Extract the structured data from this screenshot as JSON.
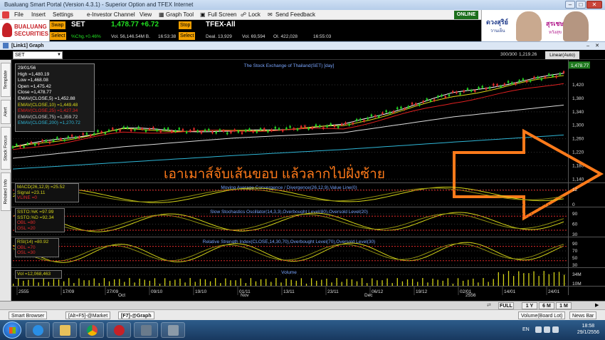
{
  "window": {
    "title": "Bualuang Smart Portal (Version 4.3.1) - Superior Option and TFEX Internet"
  },
  "menu": {
    "items": [
      "File",
      "Insert",
      "Settings",
      "e-Investor Channel",
      "View",
      "Graph Tool",
      "Full Screen",
      "Lock",
      "Send Feedback"
    ],
    "online": "ONLINE"
  },
  "brand": {
    "line1": "BUALUANG",
    "line2": "SECURITIES"
  },
  "ad": {
    "text1": "ดวงสุริย์",
    "sub1": "วานเย็น",
    "text2": "สุรเชษฐ์",
    "sub2": "หวังสุข"
  },
  "ticker": {
    "swap_label": "Swap",
    "select_label": "Select",
    "set": {
      "symbol": "SET",
      "price": "1,478.77 +6.72",
      "pct": "%Chg.+0.46%",
      "vol": "Vol. 56,146.54M B.",
      "time": "16:53:38"
    },
    "stop_label": "Stop",
    "tfex": {
      "symbol": "TFEX-All",
      "deal": "Deal. 13,929",
      "vol": "Vol. 69,594",
      "oi": "OI. 422,028",
      "time": "16:55:03"
    }
  },
  "chart_window": {
    "title": "[Link1] Graph",
    "symbol_select": "SET",
    "bar_count": "300/300",
    "price_readout": "1,219.26",
    "scale_mode": "Linear(Auto)"
  },
  "side_tabs": [
    "Template",
    "Alert",
    "Stock Focus",
    "Related Info"
  ],
  "info_box": {
    "date": "29/01/56",
    "high": "High  =1,480.19",
    "low": "Low  =1,468.08",
    "open": "Open  =1,475.42",
    "close": "Close  =1,478.77",
    "ema5": "EMAV(CLOSE,5)  =1,452.88",
    "ema10": "EMAV(CLOSE,10)  =1,449.48",
    "ema25": "EMAV(CLOSE,25)  =1,427.34",
    "ema75": "EMAV(CLOSE,75)  =1,359.72",
    "ema200": "EMAV(CLOSE,200)  =1,270.72"
  },
  "colors": {
    "ema5": "#ffffff",
    "ema10": "#d8d818",
    "ema25": "#e02020",
    "ema75": "#dcdcdc",
    "ema200": "#2fb6d6",
    "up": "#22d022",
    "down": "#e02a2a",
    "annotation": "#ff7a1a",
    "panel_line": "#d4d418",
    "grid": "#333333",
    "axis_label": "#dddddd"
  },
  "annotation": {
    "text": "เอาเมาส์จับเส้นขอบ แล้วลากไปฝั่งซ้าย"
  },
  "chart_data": [
    {
      "type": "candlestick",
      "title": "The Stock Exchange of Thailand(SET) [day]",
      "y_ticks": [
        "1,420",
        "1,380",
        "1,340",
        "1,300",
        "1,260",
        "1,220",
        "1,180",
        "1,140"
      ],
      "ylim": [
        1130,
        1490
      ],
      "last_price_label": "1,478.77",
      "series": [
        {
          "name": "EMAV(CLOSE,5)",
          "x": [
            0,
            0.2,
            0.4,
            0.6,
            0.8,
            1.0
          ],
          "values": [
            1235,
            1290,
            1280,
            1300,
            1395,
            1453
          ]
        },
        {
          "name": "EMAV(CLOSE,10)",
          "x": [
            0,
            0.2,
            0.4,
            0.6,
            0.8,
            1.0
          ],
          "values": [
            1232,
            1287,
            1282,
            1297,
            1385,
            1449
          ]
        },
        {
          "name": "EMAV(CLOSE,25)",
          "x": [
            0,
            0.2,
            0.4,
            0.6,
            0.8,
            1.0
          ],
          "values": [
            1225,
            1278,
            1283,
            1290,
            1368,
            1427
          ]
        },
        {
          "name": "EMAV(CLOSE,75)",
          "x": [
            0,
            0.2,
            0.4,
            0.6,
            0.8,
            1.0
          ],
          "values": [
            1202,
            1236,
            1262,
            1278,
            1325,
            1360
          ]
        },
        {
          "name": "EMAV(CLOSE,200)",
          "x": [
            0,
            0.2,
            0.4,
            0.6,
            0.8,
            1.0
          ],
          "values": [
            1170,
            1190,
            1210,
            1228,
            1250,
            1271
          ]
        }
      ]
    },
    {
      "type": "line",
      "title": "Moving Average Convergence / Divergence(26,12,9),Value Line(0)",
      "legend": {
        "macd": "MACD(26,12,9)  =25.52",
        "signal": "Signal  =23.11",
        "vline": "VLINE  =0"
      },
      "y_ticks": [
        "12",
        "0"
      ]
    },
    {
      "type": "line",
      "title": "Slow Stochastics Oscillator(14,3,3),Overbought Level(80),Oversold Level(20)",
      "legend": {
        "k": "SSTO.%K  =97.99",
        "d": "SSTO.%D  =92.34",
        "obl": "OBL  =80",
        "osl": "OSL  =20"
      },
      "y_ticks": [
        "90",
        "60",
        "30"
      ]
    },
    {
      "type": "line",
      "title": "Relative Strength Index(CLOSE,14,30,70),Overbought Level(70),Oversold Level(30)",
      "legend": {
        "rsi": "RSI(14)  =80.92",
        "obl": "OBL  =70",
        "osl": "OSL  =30"
      },
      "y_ticks": [
        "90",
        "70",
        "50",
        "30"
      ]
    },
    {
      "type": "bar",
      "title": "Volume",
      "legend": {
        "vol": "Vol  =12,068,463"
      },
      "y_ticks": [
        "34M",
        "10M"
      ]
    }
  ],
  "x_axis": {
    "dates": [
      "2555",
      "17/09",
      "27/09",
      "09/10",
      "19/10",
      "01/11",
      "13/11",
      "23/11",
      "06/12",
      "19/12",
      "02/01",
      "14/01",
      "24/01"
    ],
    "months": [
      "Oct",
      "Nov",
      "Dec",
      "2556"
    ]
  },
  "period_buttons": [
    "FULL",
    "1 Y",
    "6 M",
    "1 M"
  ],
  "bottom_tabs": [
    "Smart Browser",
    "[Alt+F5]-@Market",
    "[F7]-@Graph"
  ],
  "bottom_right": {
    "volume_board": "Volume(Board Lot)",
    "news": "News Bar"
  },
  "taskbar": {
    "lang": "EN",
    "time": "18:58",
    "date": "29/1/2556"
  }
}
